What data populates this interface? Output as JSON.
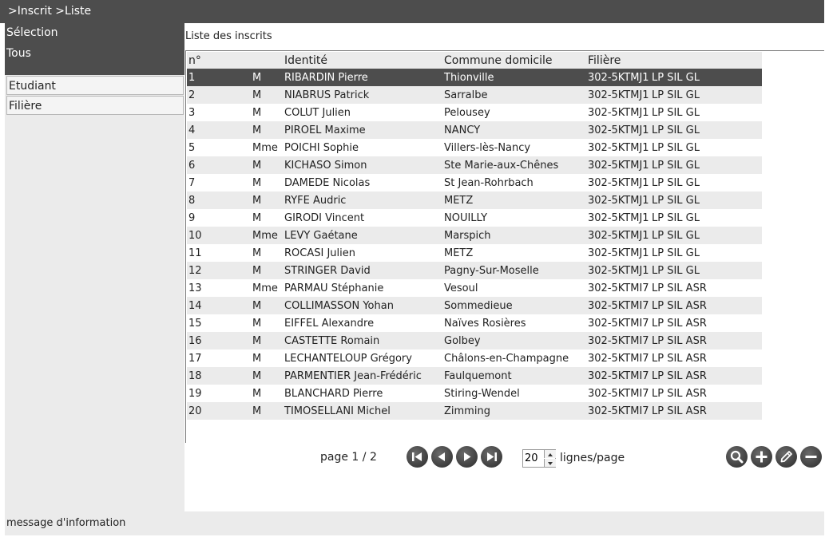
{
  "breadcrumb": ">Inscrit >Liste",
  "sidebar": {
    "heading": "Sélection",
    "subheading": "Tous",
    "items": [
      {
        "label": "Etudiant"
      },
      {
        "label": "Filière"
      }
    ]
  },
  "main": {
    "title": "Liste des inscrits",
    "columns": [
      "n°",
      "",
      "Identité",
      "Commune domicile",
      "Filière"
    ],
    "rows": [
      {
        "n": "1",
        "civ": "M",
        "identite": "RIBARDIN Pierre",
        "commune": "Thionville",
        "code": "302-5KTMJ1",
        "filiere": "LP SIL GL"
      },
      {
        "n": "2",
        "civ": "M",
        "identite": "NIABRUS Patrick",
        "commune": "Sarralbe",
        "code": "302-5KTMJ1",
        "filiere": "LP SIL GL"
      },
      {
        "n": "3",
        "civ": "M",
        "identite": "COLUT Julien",
        "commune": "Pelousey",
        "code": "302-5KTMJ1",
        "filiere": "LP SIL GL"
      },
      {
        "n": "4",
        "civ": "M",
        "identite": "PIROEL Maxime",
        "commune": "NANCY",
        "code": "302-5KTMJ1",
        "filiere": "LP SIL GL"
      },
      {
        "n": "5",
        "civ": "Mme",
        "identite": "POICHI Sophie",
        "commune": "Villers-lès-Nancy",
        "code": "302-5KTMJ1",
        "filiere": "LP SIL GL"
      },
      {
        "n": "6",
        "civ": "M",
        "identite": "KICHASO Simon",
        "commune": "Ste Marie-aux-Chênes",
        "code": "302-5KTMJ1",
        "filiere": "LP SIL GL"
      },
      {
        "n": "7",
        "civ": "M",
        "identite": "DAMEDE Nicolas",
        "commune": "St Jean-Rohrbach",
        "code": "302-5KTMJ1",
        "filiere": "LP SIL GL"
      },
      {
        "n": "8",
        "civ": "M",
        "identite": "RYFE Audric",
        "commune": "METZ",
        "code": "302-5KTMJ1",
        "filiere": "LP SIL GL"
      },
      {
        "n": "9",
        "civ": "M",
        "identite": "GIRODI Vincent",
        "commune": "NOUILLY",
        "code": "302-5KTMJ1",
        "filiere": "LP SIL GL"
      },
      {
        "n": "10",
        "civ": "Mme",
        "identite": "LEVY Gaétane",
        "commune": "Marspich",
        "code": "302-5KTMJ1",
        "filiere": "LP SIL GL"
      },
      {
        "n": "11",
        "civ": "M",
        "identite": "ROCASI Julien",
        "commune": "METZ",
        "code": "302-5KTMJ1",
        "filiere": "LP SIL GL"
      },
      {
        "n": "12",
        "civ": "M",
        "identite": "STRINGER David",
        "commune": "Pagny-Sur-Moselle",
        "code": "302-5KTMJ1",
        "filiere": "LP SIL GL"
      },
      {
        "n": "13",
        "civ": "Mme",
        "identite": "PARMAU Stéphanie",
        "commune": "Vesoul",
        "code": "302-5KTMI7",
        "filiere": "LP SIL ASR"
      },
      {
        "n": "14",
        "civ": "M",
        "identite": "COLLIMASSON Yohan",
        "commune": "Sommedieue",
        "code": "302-5KTMI7",
        "filiere": "LP SIL ASR"
      },
      {
        "n": "15",
        "civ": "M",
        "identite": "EIFFEL Alexandre",
        "commune": "Naïves Rosières",
        "code": "302-5KTMI7",
        "filiere": "LP SIL ASR"
      },
      {
        "n": "16",
        "civ": "M",
        "identite": "CASTETTE Romain",
        "commune": "Golbey",
        "code": "302-5KTMI7",
        "filiere": "LP SIL ASR"
      },
      {
        "n": "17",
        "civ": "M",
        "identite": "LECHANTELOUP Grégory",
        "commune": "Châlons-en-Champagne",
        "code": "302-5KTMI7",
        "filiere": "LP SIL ASR"
      },
      {
        "n": "18",
        "civ": "M",
        "identite": "PARMENTIER Jean-Frédéric",
        "commune": "Faulquemont",
        "code": "302-5KTMI7",
        "filiere": "LP SIL ASR"
      },
      {
        "n": "19",
        "civ": "M",
        "identite": "BLANCHARD Pierre",
        "commune": "Stiring-Wendel",
        "code": "302-5KTMI7",
        "filiere": "LP SIL ASR"
      },
      {
        "n": "20",
        "civ": "M",
        "identite": "TIMOSELLANI Michel",
        "commune": "Zimming",
        "code": "302-5KTMI7",
        "filiere": "LP SIL ASR"
      }
    ],
    "selected_row": "1"
  },
  "pager": {
    "page_text": "page 1 / 2",
    "lines_per_page": "20",
    "lines_label": "lignes/page",
    "nav_icons": [
      "first-page-icon",
      "previous-page-icon",
      "next-page-icon",
      "last-page-icon"
    ],
    "action_icons": [
      "search-icon",
      "add-icon",
      "edit-icon",
      "remove-icon"
    ]
  },
  "status": {
    "message": "message d'information"
  },
  "colors": {
    "dark_bar": "#4d4d4d",
    "panel": "#ebebeb",
    "selected_row": "#4d4d4d"
  }
}
